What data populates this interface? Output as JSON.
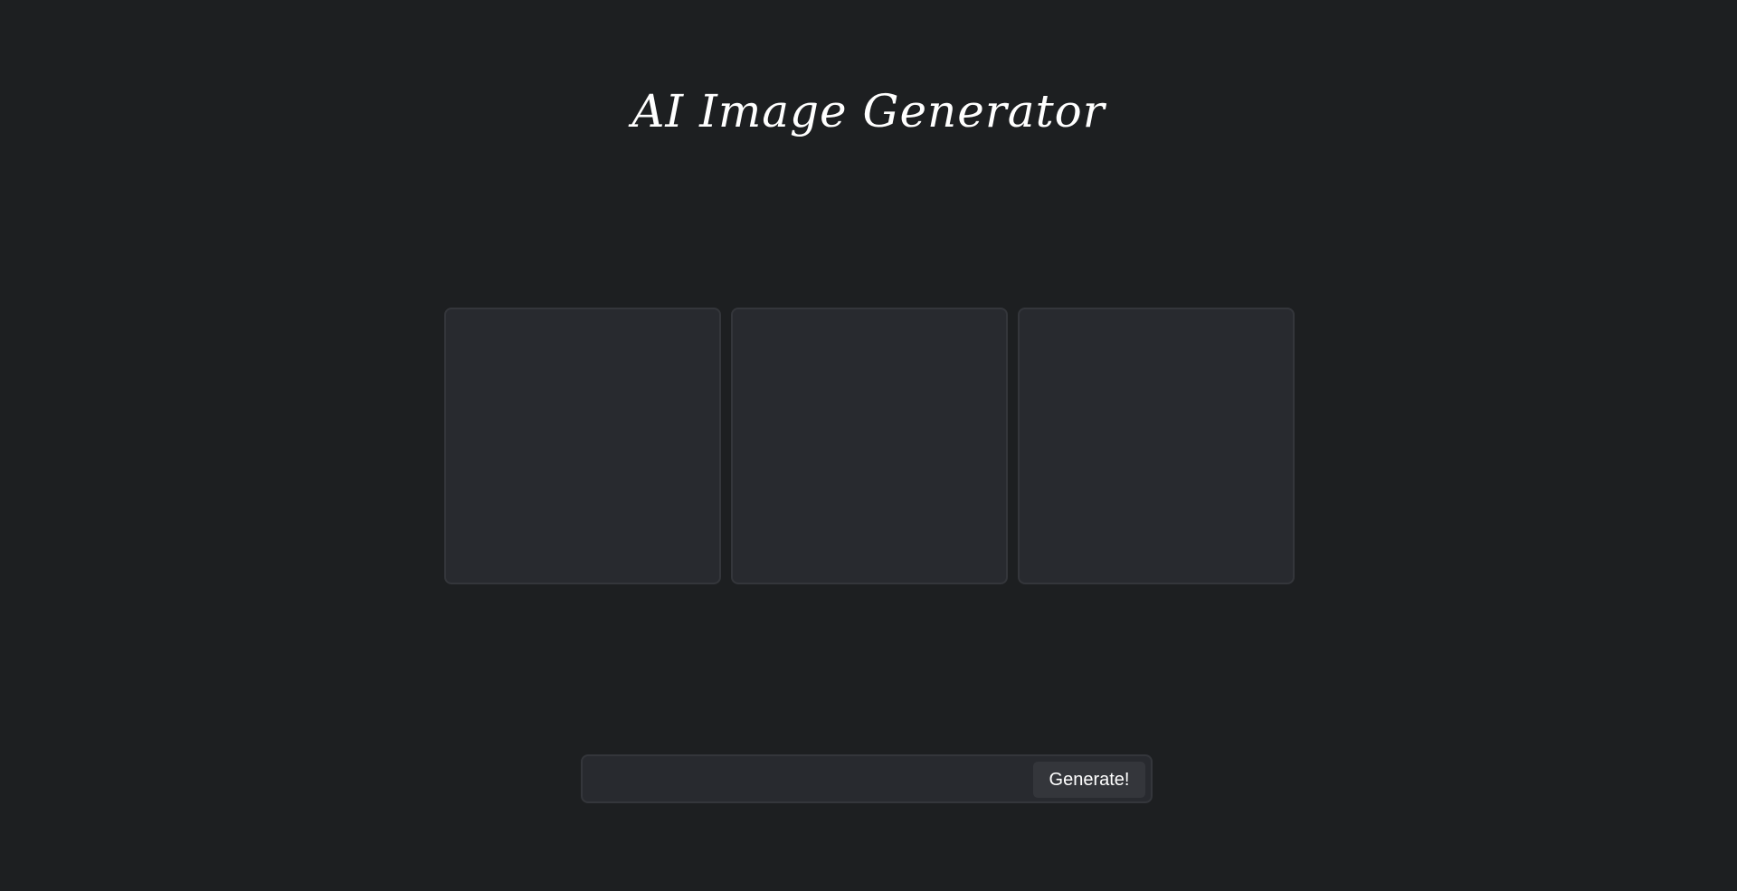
{
  "header": {
    "title": "AI Image Generator"
  },
  "gallery": {
    "slots": [
      "",
      "",
      ""
    ]
  },
  "prompt": {
    "value": "",
    "placeholder": "",
    "button_label": "Generate!"
  },
  "colors": {
    "background": "#1d1f21",
    "panel": "#282a2f",
    "border": "#34363b",
    "button": "#34363b",
    "text": "#ffffff"
  }
}
